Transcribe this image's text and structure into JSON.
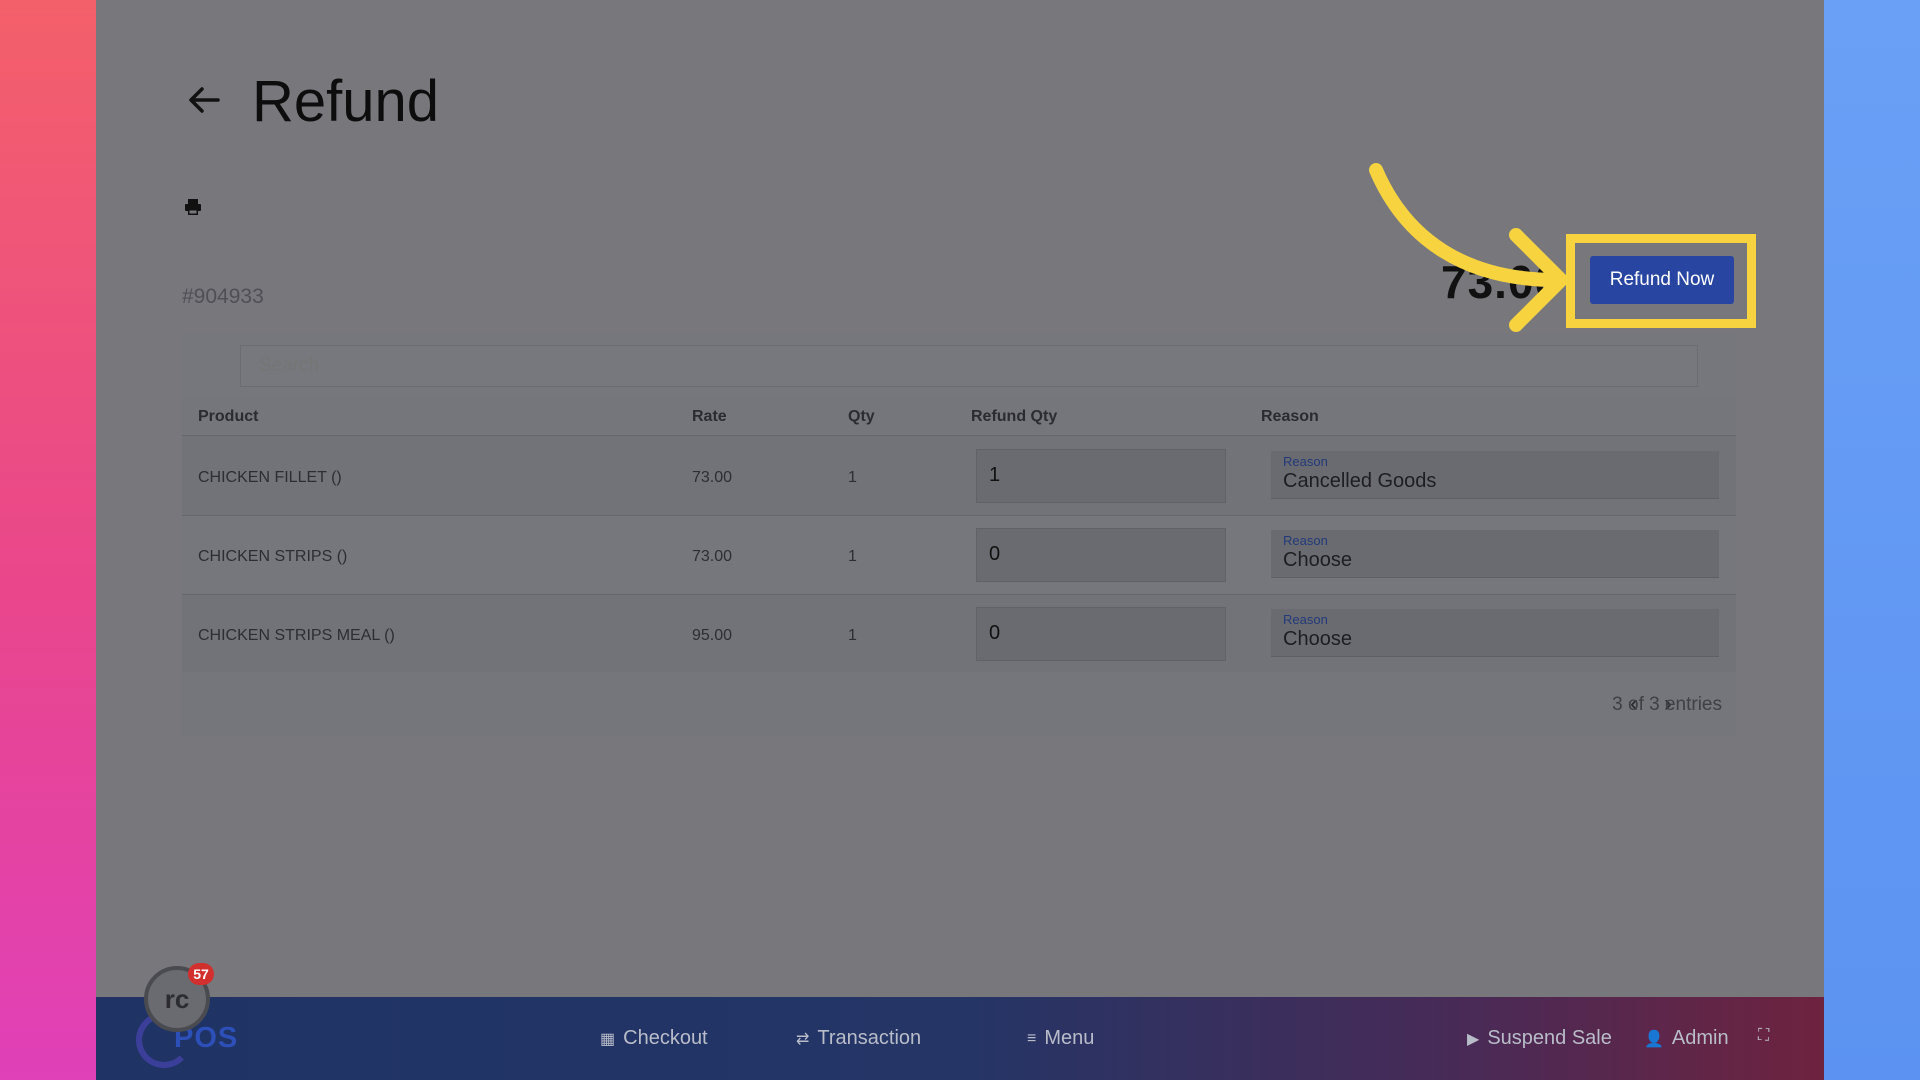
{
  "page": {
    "title": "Refund",
    "order_number": "#904933",
    "total": "73.00"
  },
  "actions": {
    "refund_now": "Refund Now"
  },
  "search": {
    "placeholder": "Search"
  },
  "table": {
    "headers": [
      "Product",
      "Rate",
      "Qty",
      "Refund Qty",
      "Reason"
    ],
    "rows": [
      {
        "product": "CHICKEN FILLET ()",
        "rate": "73.00",
        "qty": "1",
        "refund_qty": "1",
        "reason_label": "Reason",
        "reason_value": "Cancelled Goods"
      },
      {
        "product": "CHICKEN STRIPS ()",
        "rate": "73.00",
        "qty": "1",
        "refund_qty": "0",
        "reason_label": "Reason",
        "reason_value": "Choose"
      },
      {
        "product": "CHICKEN STRIPS MEAL ()",
        "rate": "95.00",
        "qty": "1",
        "refund_qty": "0",
        "reason_label": "Reason",
        "reason_value": "Choose"
      }
    ]
  },
  "pagination": {
    "text": "3 of 3 entries",
    "prev": "‹",
    "next": "›"
  },
  "bottom_nav": {
    "logo": "POS",
    "badge_count": "57",
    "avatar_text": "rc",
    "items": [
      "Checkout",
      "Transaction",
      "Menu"
    ],
    "suspend_sale": "Suspend Sale",
    "admin": "Admin"
  },
  "colors": {
    "highlight": "#f6d33f",
    "primary": "#2745a1"
  },
  "icons": [
    "back-arrow-icon",
    "print-icon",
    "grid-icon",
    "swap-icon",
    "menu-icon",
    "play-icon",
    "user-icon",
    "fullscreen-icon"
  ]
}
